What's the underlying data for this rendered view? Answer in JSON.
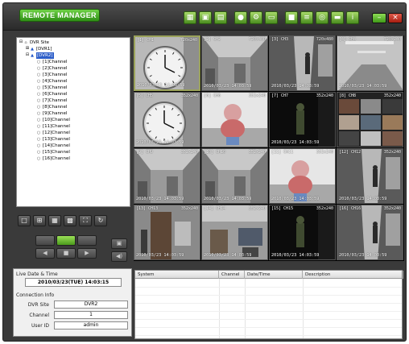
{
  "app": {
    "title": "REMOTE MANAGER"
  },
  "tree": {
    "items": [
      {
        "label": "DVR Site",
        "depth": 0,
        "expander": "⊟",
        "icon": "site-icon"
      },
      {
        "label": "[DVR1]",
        "depth": 1,
        "expander": "⊞",
        "icon": "dvr-icon"
      },
      {
        "label": "[DVR2]",
        "depth": 1,
        "expander": "⊟",
        "icon": "dvr-icon",
        "selected": true
      },
      {
        "label": "[1]Channel",
        "depth": 2,
        "expander": "",
        "icon": "camera-icon"
      },
      {
        "label": "[2]Channel",
        "depth": 2,
        "expander": "",
        "icon": "camera-icon"
      },
      {
        "label": "[3]Channel",
        "depth": 2,
        "expander": "",
        "icon": "camera-icon"
      },
      {
        "label": "[4]Channel",
        "depth": 2,
        "expander": "",
        "icon": "camera-icon"
      },
      {
        "label": "[5]Channel",
        "depth": 2,
        "expander": "",
        "icon": "camera-icon"
      },
      {
        "label": "[6]Channel",
        "depth": 2,
        "expander": "",
        "icon": "camera-icon"
      },
      {
        "label": "[7]Channel",
        "depth": 2,
        "expander": "",
        "icon": "camera-icon"
      },
      {
        "label": "[8]Channel",
        "depth": 2,
        "expander": "",
        "icon": "camera-icon"
      },
      {
        "label": "[9]Channel",
        "depth": 2,
        "expander": "",
        "icon": "camera-icon"
      },
      {
        "label": "[10]Channel",
        "depth": 2,
        "expander": "",
        "icon": "camera-icon"
      },
      {
        "label": "[11]Channel",
        "depth": 2,
        "expander": "",
        "icon": "camera-icon"
      },
      {
        "label": "[12]Channel",
        "depth": 2,
        "expander": "",
        "icon": "camera-icon"
      },
      {
        "label": "[13]Channel",
        "depth": 2,
        "expander": "",
        "icon": "camera-icon"
      },
      {
        "label": "[14]Channel",
        "depth": 2,
        "expander": "",
        "icon": "camera-icon"
      },
      {
        "label": "[15]Channel",
        "depth": 2,
        "expander": "",
        "icon": "camera-icon"
      },
      {
        "label": "[16]Channel",
        "depth": 2,
        "expander": "",
        "icon": "camera-icon"
      }
    ]
  },
  "info": {
    "live_label": "Live Date & Time",
    "datetime": "2010/03/23(TUE) 14:03:15",
    "connection_label": "Connection Info",
    "site_label": "DVR Site",
    "site_value": "DVR2",
    "channel_label": "Channel",
    "channel_value": "1",
    "user_label": "User ID",
    "user_value": "admin"
  },
  "cameras": [
    {
      "name": "[1] CH1",
      "res": "720x240",
      "ts": "2010/03/23 14:03:59",
      "scene": "clock"
    },
    {
      "name": "[2] CH2",
      "res": "720x480",
      "ts": "2010/03/23 14:03:59",
      "scene": "room"
    },
    {
      "name": "[3] CH3",
      "res": "720x480",
      "ts": "2010/03/23 14:03:59",
      "scene": "hall"
    },
    {
      "name": "[4] CH4",
      "res": "720x240",
      "ts": "2010/03/23 14:03:59",
      "scene": "ceiling"
    },
    {
      "name": "[5] CH5",
      "res": "352x240",
      "ts": "2010/03/23 14:03:59",
      "scene": "clock"
    },
    {
      "name": "[6] CH6",
      "res": "352x240",
      "ts": "",
      "scene": "doll"
    },
    {
      "name": "[7] CH7",
      "res": "352x240",
      "ts": "2010/03/23 14:03:59",
      "scene": "dark"
    },
    {
      "name": "[8] CH8",
      "res": "352x240",
      "ts": "",
      "scene": "mosaic"
    },
    {
      "name": "[9] CH9",
      "res": "352x240",
      "ts": "2010/03/23 14:03:59",
      "scene": "room"
    },
    {
      "name": "[10] CH10",
      "res": "352x240",
      "ts": "2010/03/23 14:03:59",
      "scene": "room"
    },
    {
      "name": "[11] CH11",
      "res": "352x240",
      "ts": "2010/03/23 14:03:59",
      "scene": "doll"
    },
    {
      "name": "[12] CH12",
      "res": "352x240",
      "ts": "2010/03/23 14:03:59",
      "scene": "hall"
    },
    {
      "name": "[13] CH13",
      "res": "352x240",
      "ts": "2010/03/23 14:03:59",
      "scene": "door"
    },
    {
      "name": "[14] CH14",
      "res": "352x240",
      "ts": "2010/03/23 14:03:59",
      "scene": "office"
    },
    {
      "name": "[15] CH15",
      "res": "352x240",
      "ts": "2010/03/23 14:03:59",
      "scene": "dark"
    },
    {
      "name": "[16] CH16",
      "res": "352x240",
      "ts": "2010/03/23 14:03:59",
      "scene": "hall"
    }
  ],
  "event_columns": [
    "System",
    "Channel",
    "Date/Time",
    "Description"
  ],
  "colors": {
    "accent": "#4db12a",
    "selection": "#9aa25a",
    "frame": "#3a3a3a"
  }
}
